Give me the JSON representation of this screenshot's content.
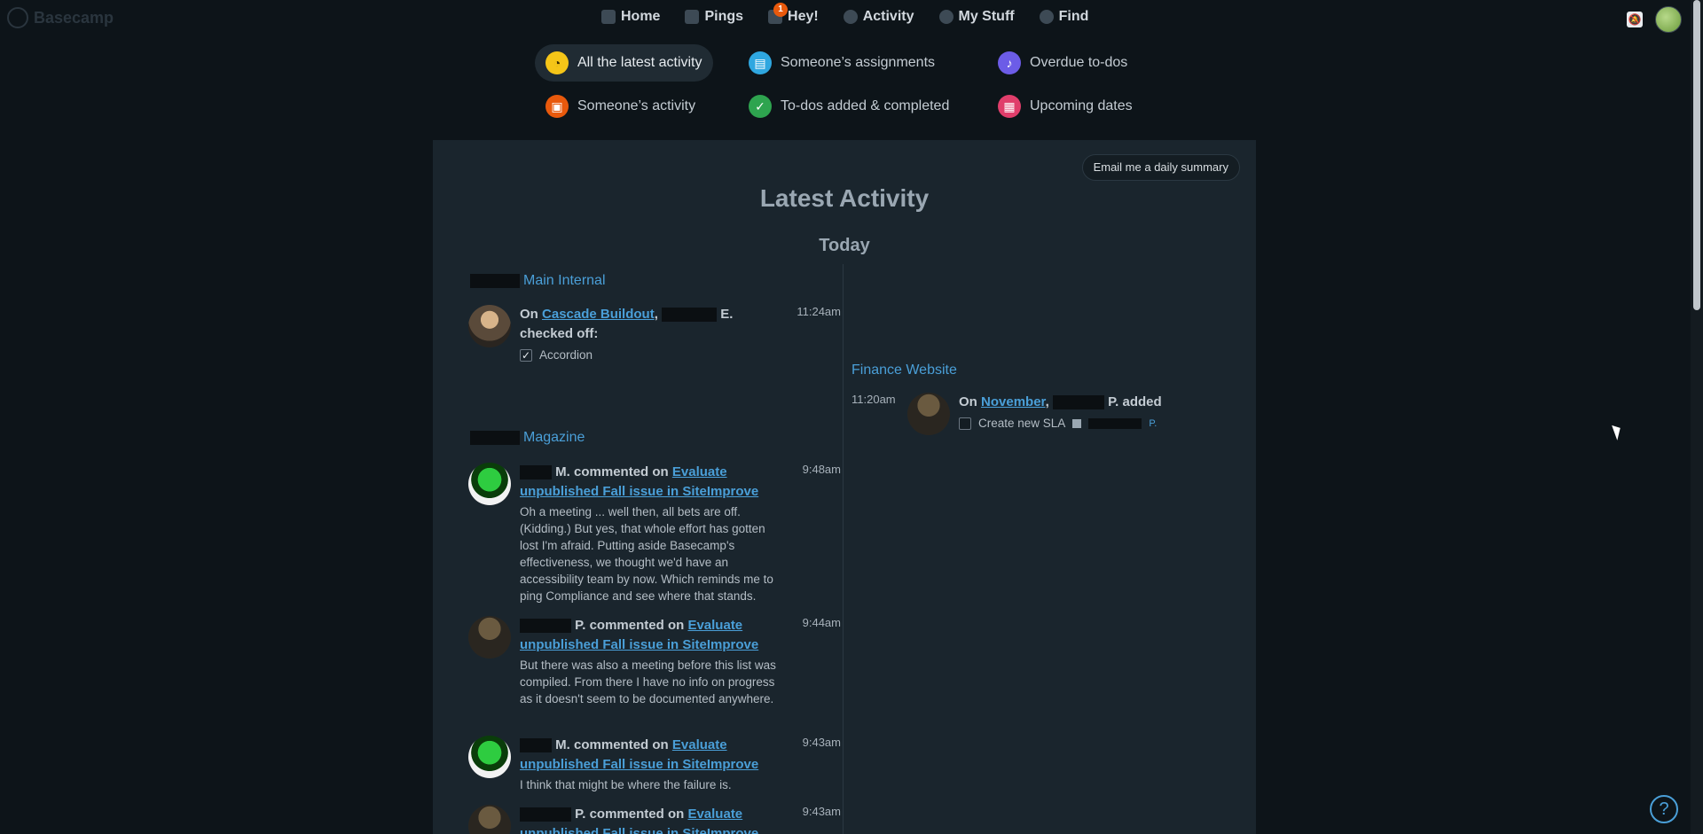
{
  "app": {
    "name": "Basecamp"
  },
  "nav": {
    "home": "Home",
    "pings": "Pings",
    "hey": "Hey!",
    "hey_badge": "1",
    "activity": "Activity",
    "mystuff": "My Stuff",
    "find": "Find"
  },
  "filters": {
    "latest": "All the latest activity",
    "assignments": "Someone’s assignments",
    "overdue": "Overdue to-dos",
    "someone_activity": "Someone’s activity",
    "todos": "To-dos added & completed",
    "upcoming": "Upcoming dates"
  },
  "panel": {
    "email_button": "Email me a daily summary",
    "title": "Latest Activity",
    "day": "Today"
  },
  "left_column": {
    "project1": "Main Internal",
    "item1": {
      "prefix": "On",
      "link": "Cascade Buildout",
      "name": "E.",
      "action": "checked off:",
      "check_label": "Accordion",
      "time": "11:24am"
    },
    "project2": "Magazine",
    "item2": {
      "name": "M.",
      "action": "commented on",
      "link": "Evaluate unpublished Fall issue in SiteImprove",
      "snippet": "Oh a meeting ... well then, all bets are off. (Kidding.) But yes, that whole effort has gotten lost I'm afraid.  Putting aside Basecamp's effectiveness, we thought we'd have an accessibility team by now. Which reminds me to ping Compliance and see where that stands.",
      "time": "9:48am"
    },
    "item3": {
      "name": "P.",
      "action": "commented on",
      "link": "Evaluate unpublished Fall issue in SiteImprove",
      "snippet": "But there was also a meeting before this list was compiled. From there I have no info on progress as it doesn't seem to be documented anywhere.",
      "time": "9:44am"
    },
    "item4": {
      "name": "M.",
      "action": "commented on",
      "link": "Evaluate unpublished Fall issue in SiteImprove",
      "snippet": "I think that might be where the failure is.",
      "time": "9:43am"
    },
    "item5": {
      "name": "P.",
      "action": "commented on",
      "link": "Evaluate unpublished Fall issue in SiteImprove",
      "time": "9:43am"
    }
  },
  "right_column": {
    "project": "Finance Website",
    "item": {
      "prefix": "On",
      "link": "November",
      "name": "P.",
      "action": "added",
      "check_label": "Create new SLA",
      "assignee_initial": "P.",
      "time": "11:20am"
    }
  },
  "help": "?"
}
